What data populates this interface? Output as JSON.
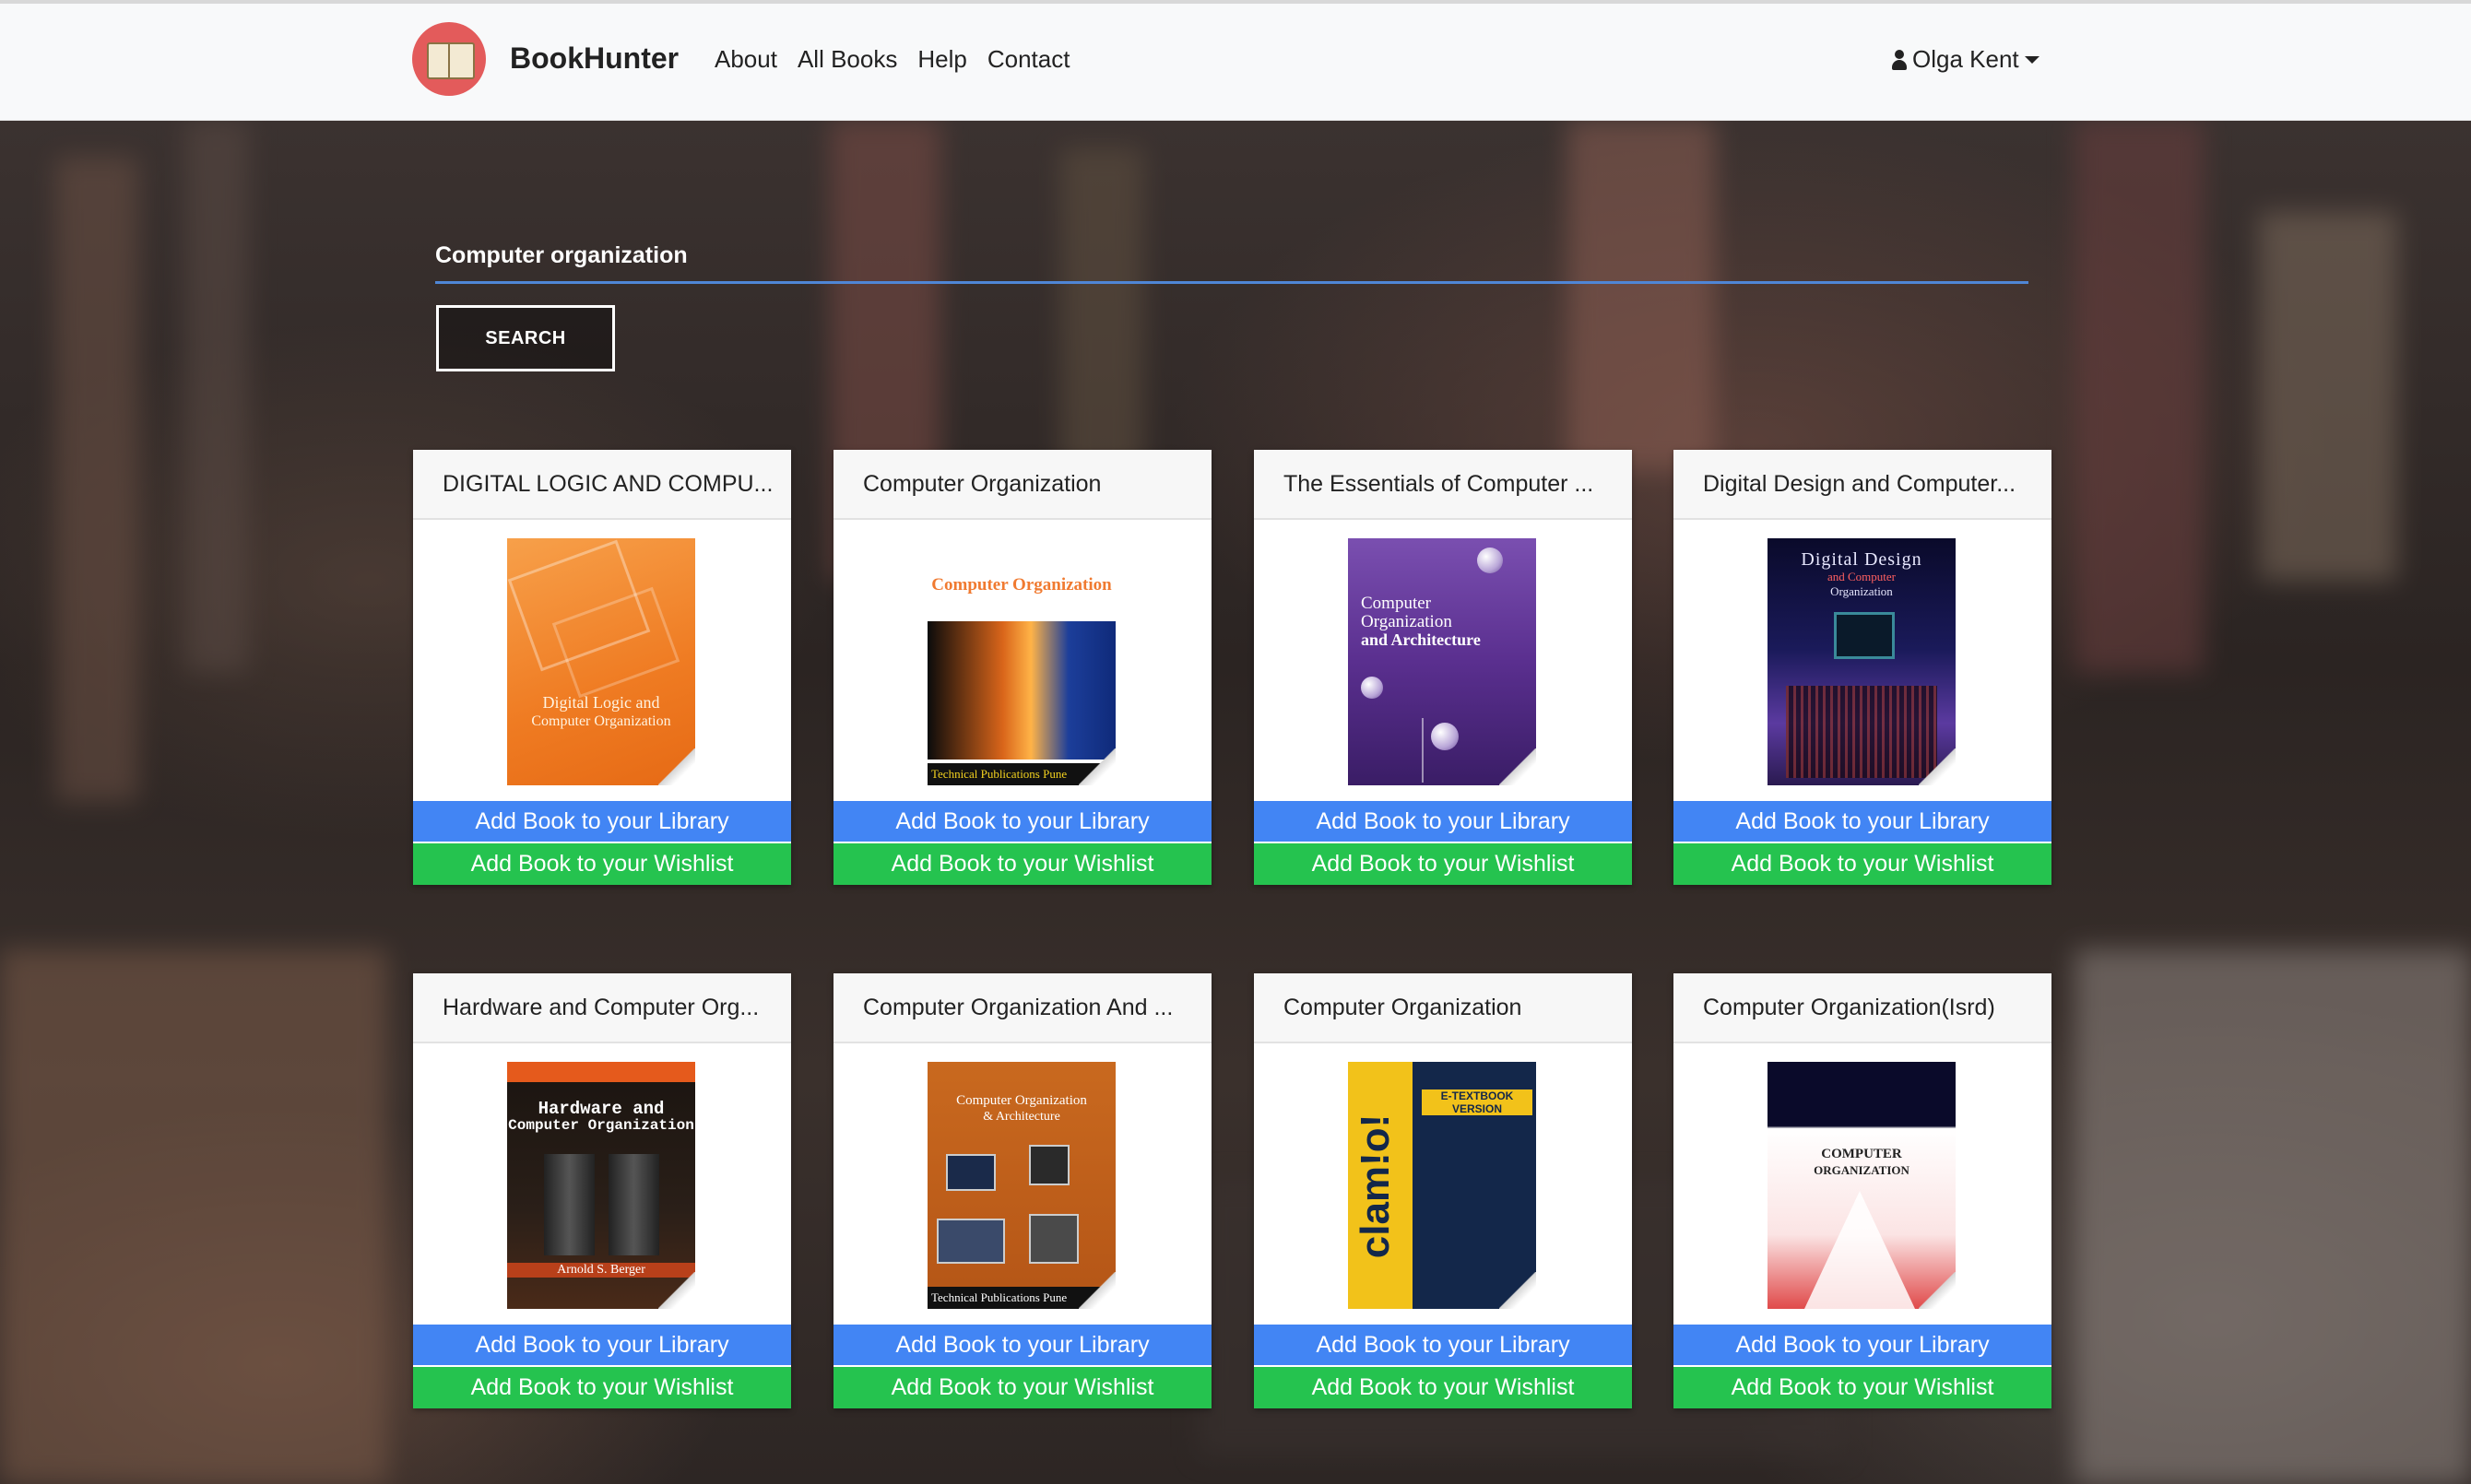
{
  "nav": {
    "brand": "BookHunter",
    "links": [
      "About",
      "All Books",
      "Help",
      "Contact"
    ],
    "user": "Olga Kent"
  },
  "search": {
    "query": "Computer organization",
    "button": "SEARCH"
  },
  "colors": {
    "library_button": "#4285f4",
    "wishlist_button": "#25c34f",
    "search_underline": "#4f86d6",
    "logo": "#e35b5b"
  },
  "books": [
    {
      "title": "DIGITAL LOGIC AND COMPU...",
      "cover": {
        "lines": [
          "Digital Logic and",
          "Computer Organization"
        ]
      }
    },
    {
      "title": "Computer Organization",
      "cover": {
        "lines": [
          "Computer Organization",
          "Technical Publications Pune"
        ]
      }
    },
    {
      "title": "The Essentials of Computer ...",
      "cover": {
        "lines": [
          "Computer",
          "Organization",
          "and Architecture"
        ]
      }
    },
    {
      "title": "Digital Design and Computer...",
      "cover": {
        "lines": [
          "Digital Design",
          "and Computer",
          "Organization"
        ]
      }
    },
    {
      "title": "Hardware and Computer Org...",
      "cover": {
        "lines": [
          "Hardware and",
          "Computer Organization",
          "Arnold S. Berger"
        ]
      }
    },
    {
      "title": "Computer Organization And ...",
      "cover": {
        "lines": [
          "Computer Organization",
          "& Architecture",
          "Technical Publications Pune"
        ]
      }
    },
    {
      "title": "Computer Organization",
      "cover": {
        "lines": [
          "clam!o!",
          "E-TEXTBOOK VERSION"
        ]
      }
    },
    {
      "title": "Computer Organization(Isrd)",
      "cover": {
        "lines": [
          "COMPUTER",
          "ORGANIZATION"
        ]
      }
    }
  ],
  "actions": {
    "library": "Add Book to your Library",
    "wishlist": "Add Book to your Wishlist"
  }
}
